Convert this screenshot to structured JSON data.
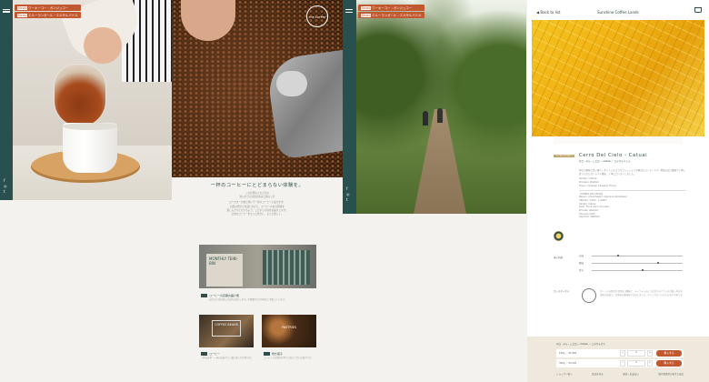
{
  "news": [
    {
      "tag": "News",
      "text": "ワーキーコー・ガンジュコー"
    },
    {
      "tag": "News",
      "text": "エルーランガール・エルサルバドル"
    }
  ],
  "sidebar": {
    "menu_label": "MENU",
    "sns": [
      "f",
      "◎",
      "t"
    ]
  },
  "hero": {
    "logo": "THE COFFEE"
  },
  "intro": {
    "heading": "一杯のコーヒーにとどまらない体験を。",
    "lines": [
      "この世界のさまざまな",
      "知られざる自然の恵みと暮らしを",
      "ロースターの技と想いで一杯のコーヒーに届けます。",
      "自然の豊かさを感じながら、コーヒーのある時間を",
      "楽しんでいただけるよう、こだわりの豆をお届けします。",
      "日常のコーヒーをもっと豊かに、もっと楽しく。"
    ]
  },
  "products": {
    "monthly": {
      "title": "MONTHLY TEIKI-BIN",
      "caption": "コーヒーの定期お届け便",
      "desc": "お好きな豆を選んで毎月お届けします。定期便だけの特典もご用意しています。"
    },
    "coffee": {
      "title": "COFFEE BEANS",
      "caption": "コーヒー",
      "desc": "一杯のお茶・一杯のお菓子と一緒に楽しむ世界の豆。"
    },
    "pastries": {
      "title": "PASTRIES",
      "caption": "焼き菓子",
      "desc": "コーヒーとの相性を考えて焼き上げたお菓子です。"
    }
  },
  "detail": {
    "back": "◀ Back to list",
    "brand": "Sunshine Coffee Lands",
    "cart_icon": "cart-icon",
    "badge": "Limited Edition",
    "title": "Cerro Del Cielo - Catuai",
    "subtitle": "セロ・デル・シエロ ― Catuai ／ エルサルバドル",
    "description": "明るい酸味と甘い香り、オレンジのようなフレッシュさが魅力のコーヒーです。標高の高い農園で丁寧に育てられたカトゥアイ種を、丁寧にローストしました。",
    "profile_lines": [
      "Variety / Catuai",
      "Process / Washed",
      "Flavor / Orange, Caramel, Honey"
    ],
    "spec_lines": [
      "【CERRO DEL CIELO】",
      "Region: Ahuachapán, Apaneca-Ilamatepec",
      "Altitude: 1,400 - 1,600m",
      "Variety: Catuai",
      "Farm: Finca Cerro del Cielo",
      "Process: Washed",
      "Harvest: 2023",
      "Importer: WATARU"
    ],
    "seal": "seal",
    "taste_label": "味の特徴",
    "taste": [
      {
        "label": "苦味",
        "level": 0.28
      },
      {
        "label": "酸味",
        "level": 0.72
      },
      {
        "label": "甘み",
        "level": 0.55
      }
    ],
    "roaster_label": "ロースターから",
    "roaster_note": "オレンジを思わせる明るい酸味と、キャラメルのような甘さのバランスが楽しめます。浅めの焙煎で、豆本来の風味を引き出しました。ホットでもアイスでもおすすめです。",
    "cart": {
      "heading": "セロ・デル・シエロ ― Catuai ／ このサイズで",
      "options": [
        {
          "label": "150g ／ ¥1,680",
          "qty": "1",
          "button": "購入する"
        },
        {
          "label": "300g ／ ¥3,200",
          "qty": "1",
          "button": "購入する"
        }
      ],
      "footer_links": [
        "ショップ一覧へ",
        "商品を見る",
        "配送・お支払い",
        "販売事業者の表示と返品"
      ]
    }
  }
}
